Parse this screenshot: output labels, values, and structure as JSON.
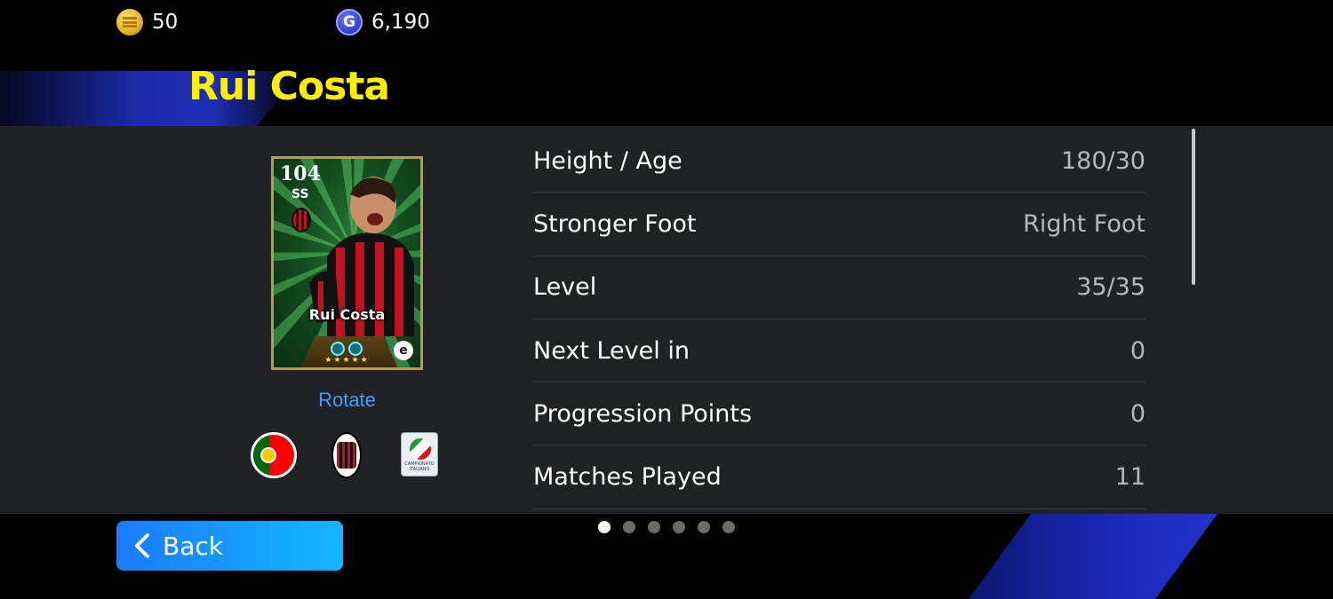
{
  "currency": {
    "coins": "50",
    "gp": "6,190",
    "gp_symbol": "G"
  },
  "player": {
    "name": "Rui Costa",
    "card": {
      "rating": "104",
      "position": "SS",
      "name": "Rui Costa",
      "stars": "★★★★★",
      "brand": "e"
    },
    "rotate_label": "Rotate",
    "badges": {
      "nationality": "portugal-flag-icon",
      "club": "ac-milan-crest-icon",
      "league": "serie-a-badge-icon",
      "league_text": "CAMPIONATO ITALIANO"
    }
  },
  "stats": [
    {
      "label": "Height / Age",
      "value": "180/30"
    },
    {
      "label": "Stronger Foot",
      "value": "Right Foot"
    },
    {
      "label": "Level",
      "value": "35/35"
    },
    {
      "label": "Next Level in",
      "value": "0"
    },
    {
      "label": "Progression Points",
      "value": "0"
    },
    {
      "label": "Matches Played",
      "value": "11"
    }
  ],
  "footer": {
    "back_label": "Back",
    "page_count": 6,
    "active_page": 1
  },
  "colors": {
    "name_yellow": "#ffee00",
    "panel_bg": "#202225",
    "accent_blue": "#1b7bff",
    "link_blue": "#3aa0ff"
  }
}
